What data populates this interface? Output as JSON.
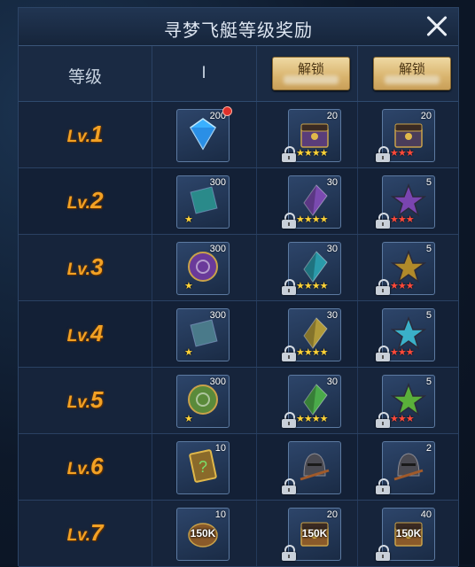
{
  "title": "寻梦飞艇等级奖励",
  "header": {
    "level_label": "等级",
    "free_col_label": "I",
    "unlock_btn_1": "解锁",
    "unlock_btn_2": "解锁"
  },
  "rows": [
    {
      "level_prefix": "Lv.",
      "level_num": "1",
      "free": {
        "icon": "blue-diamond-icon",
        "count": "200",
        "stars": "",
        "red_dot": true,
        "color": "#3ab0ff"
      },
      "paid1": {
        "icon": "treasure-chest-icon",
        "count": "20",
        "stars": "★★★★",
        "star_color": "gold",
        "color": "#5a3d7a"
      },
      "paid2": {
        "icon": "treasure-chest-icon",
        "count": "20",
        "stars": "★★★",
        "star_color": "red",
        "color": "#4a3d5a"
      }
    },
    {
      "level_prefix": "Lv.",
      "level_num": "2",
      "free": {
        "icon": "teal-rune-stone-icon",
        "count": "300",
        "stars": "★",
        "color": "#2a8a8a"
      },
      "paid1": {
        "icon": "purple-crystal-shard-icon",
        "count": "30",
        "stars": "★★★★",
        "star_color": "gold",
        "color": "#7a4ab0"
      },
      "paid2": {
        "icon": "purple-star-emblem-icon",
        "count": "5",
        "stars": "★★★",
        "star_color": "red",
        "color": "#7a45b0"
      }
    },
    {
      "level_prefix": "Lv.",
      "level_num": "3",
      "free": {
        "icon": "purple-rune-disc-icon",
        "count": "300",
        "stars": "★",
        "color": "#6a3a9a"
      },
      "paid1": {
        "icon": "teal-crystal-shard-icon",
        "count": "30",
        "stars": "★★★★",
        "star_color": "gold",
        "color": "#2a9aaa"
      },
      "paid2": {
        "icon": "gold-star-emblem-icon",
        "count": "5",
        "stars": "★★★",
        "star_color": "red",
        "color": "#b08a2a"
      }
    },
    {
      "level_prefix": "Lv.",
      "level_num": "4",
      "free": {
        "icon": "stone-wedge-icon",
        "count": "300",
        "stars": "★",
        "color": "#4a7a8a"
      },
      "paid1": {
        "icon": "gold-crystal-shard-icon",
        "count": "30",
        "stars": "★★★★",
        "star_color": "gold",
        "color": "#b09a3a"
      },
      "paid2": {
        "icon": "cyan-star-emblem-icon",
        "count": "5",
        "stars": "★★★",
        "star_color": "red",
        "color": "#3ab0c8"
      }
    },
    {
      "level_prefix": "Lv.",
      "level_num": "5",
      "free": {
        "icon": "green-rune-disc-icon",
        "count": "300",
        "stars": "★",
        "color": "#5a8a3a"
      },
      "paid1": {
        "icon": "green-crystal-shard-icon",
        "count": "30",
        "stars": "★★★★",
        "star_color": "gold",
        "color": "#4aaa4a"
      },
      "paid2": {
        "icon": "green-star-emblem-icon",
        "count": "5",
        "stars": "★★★",
        "star_color": "red",
        "color": "#5ab03a"
      }
    },
    {
      "level_prefix": "Lv.",
      "level_num": "6",
      "free": {
        "icon": "mystery-card-icon",
        "count": "10",
        "stars": "",
        "color": "#8a6a2a"
      },
      "paid1": {
        "icon": "knight-helmet-icon",
        "count": "",
        "stars": "",
        "color": "#6a5a4a"
      },
      "paid2": {
        "icon": "knight-helmet-icon",
        "count": "2",
        "stars": "",
        "color": "#6a5a4a"
      }
    },
    {
      "level_prefix": "Lv.",
      "level_num": "7",
      "free": {
        "icon": "coin-pouch-icon",
        "count": "10",
        "amount": "150K",
        "stars": "",
        "color": "#8a5a2a"
      },
      "paid1": {
        "icon": "coin-box-icon",
        "count": "20",
        "amount": "150K",
        "stars": "",
        "color": "#8a5a2a"
      },
      "paid2": {
        "icon": "coin-box-icon",
        "count": "40",
        "amount": "150K",
        "stars": "",
        "color": "#8a5a2a"
      }
    }
  ]
}
